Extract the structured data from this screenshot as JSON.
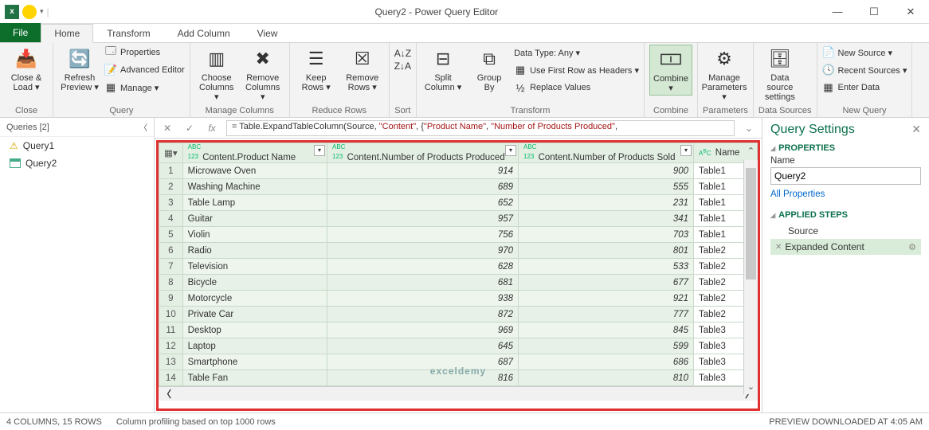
{
  "window": {
    "title": "Query2 - Power Query Editor",
    "min": "—",
    "max": "☐",
    "close": "✕"
  },
  "tabs": {
    "file": "File",
    "home": "Home",
    "transform": "Transform",
    "addcol": "Add Column",
    "view": "View"
  },
  "ribbon": {
    "groups": {
      "close": "Close",
      "query": "Query",
      "managecols": "Manage Columns",
      "reducerows": "Reduce Rows",
      "sort": "Sort",
      "transform": "Transform",
      "combine": "Combine",
      "parameters": "Parameters",
      "datasources": "Data Sources",
      "newquery": "New Query"
    },
    "btns": {
      "closeload": "Close &\nLoad ▾",
      "refresh": "Refresh\nPreview ▾",
      "properties": "Properties",
      "adveditor": "Advanced Editor",
      "manage": "Manage ▾",
      "choosecols": "Choose\nColumns ▾",
      "removecols": "Remove\nColumns ▾",
      "keeprows": "Keep\nRows ▾",
      "removerows": "Remove\nRows ▾",
      "splitcol": "Split\nColumn ▾",
      "groupby": "Group\nBy",
      "datatype": "Data Type: Any ▾",
      "firstrow": "Use First Row as Headers ▾",
      "replace": "Replace Values",
      "combine2": "Combine\n▾",
      "params": "Manage\nParameters ▾",
      "dsource": "Data source\nsettings",
      "newsource": "New Source ▾",
      "recent": "Recent Sources ▾",
      "enterdata": "Enter Data"
    }
  },
  "queries": {
    "header": "Queries [2]",
    "q1": "Query1",
    "q2": "Query2"
  },
  "formula": {
    "prefix": "= Table.ExpandTableColumn(Source, ",
    "s1": "\"Content\"",
    "mid1": ", {",
    "s2": "\"Product Name\"",
    "mid2": ", ",
    "s3": "\"Number of Products Produced\"",
    "suffix": ","
  },
  "grid": {
    "cols": {
      "c1": "Content.Product Name",
      "c2": "Content.Number of Products Produced",
      "c3": "Content.Number of Products Sold",
      "c4": "Name"
    },
    "rows": [
      {
        "n": "1",
        "p": "Microwave Oven",
        "a": "914",
        "b": "900",
        "t": "Table1"
      },
      {
        "n": "2",
        "p": "Washing Machine",
        "a": "689",
        "b": "555",
        "t": "Table1"
      },
      {
        "n": "3",
        "p": "Table Lamp",
        "a": "652",
        "b": "231",
        "t": "Table1"
      },
      {
        "n": "4",
        "p": "Guitar",
        "a": "957",
        "b": "341",
        "t": "Table1"
      },
      {
        "n": "5",
        "p": "Violin",
        "a": "756",
        "b": "703",
        "t": "Table1"
      },
      {
        "n": "6",
        "p": "Radio",
        "a": "970",
        "b": "801",
        "t": "Table2"
      },
      {
        "n": "7",
        "p": "Television",
        "a": "628",
        "b": "533",
        "t": "Table2"
      },
      {
        "n": "8",
        "p": "Bicycle",
        "a": "681",
        "b": "677",
        "t": "Table2"
      },
      {
        "n": "9",
        "p": "Motorcycle",
        "a": "938",
        "b": "921",
        "t": "Table2"
      },
      {
        "n": "10",
        "p": "Private Car",
        "a": "872",
        "b": "777",
        "t": "Table2"
      },
      {
        "n": "11",
        "p": "Desktop",
        "a": "969",
        "b": "845",
        "t": "Table3"
      },
      {
        "n": "12",
        "p": "Laptop",
        "a": "645",
        "b": "599",
        "t": "Table3"
      },
      {
        "n": "13",
        "p": "Smartphone",
        "a": "687",
        "b": "686",
        "t": "Table3"
      },
      {
        "n": "14",
        "p": "Table Fan",
        "a": "816",
        "b": "810",
        "t": "Table3"
      }
    ]
  },
  "settings": {
    "title": "Query Settings",
    "properties": "PROPERTIES",
    "nameLabel": "Name",
    "nameValue": "Query2",
    "allprops": "All Properties",
    "applied": "APPLIED STEPS",
    "step1": "Source",
    "step2": "Expanded Content"
  },
  "status": {
    "left1": "4 COLUMNS, 15 ROWS",
    "left2": "Column profiling based on top 1000 rows",
    "right": "PREVIEW DOWNLOADED AT 4:05 AM"
  },
  "watermark": "exceldemy"
}
